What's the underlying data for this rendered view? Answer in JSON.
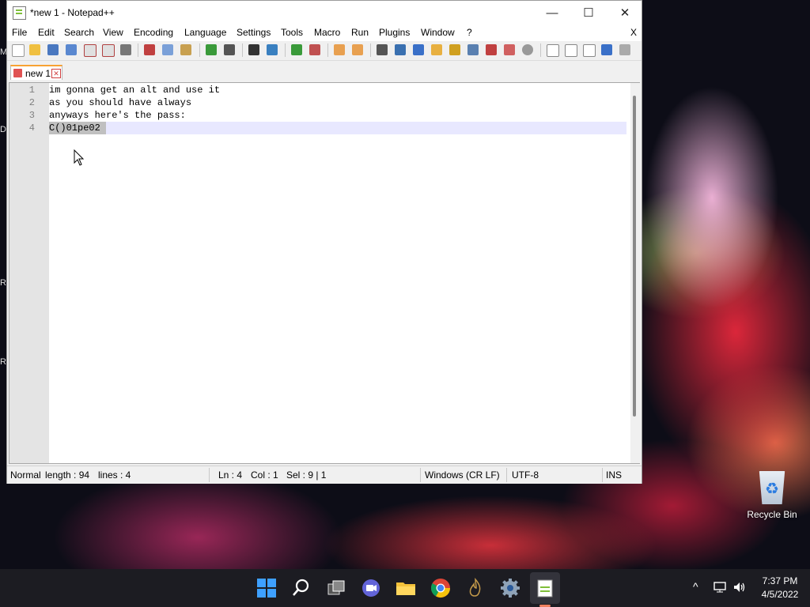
{
  "window": {
    "title": "*new 1 - Notepad++",
    "minimize": "—",
    "maximize": "☐",
    "close": "✕"
  },
  "menu": [
    "File",
    "Edit",
    "Search",
    "View",
    "Encoding",
    "Language",
    "Settings",
    "Tools",
    "Macro",
    "Run",
    "Plugins",
    "Window",
    "?"
  ],
  "menu_close": "X",
  "tab": {
    "label": "new 1",
    "close": "✕"
  },
  "editor": {
    "line_numbers": [
      "1",
      "2",
      "3",
      "4"
    ],
    "lines": [
      "im gonna get an alt and use it",
      "as you should have always",
      "anyways here's the pass:",
      "C()01pe02"
    ]
  },
  "status": {
    "mode": "Normal",
    "length": "length : 94",
    "lines": "lines : 4",
    "ln": "Ln : 4",
    "col": "Col : 1",
    "sel": "Sel : 9 | 1",
    "eol": "Windows (CR LF)",
    "encoding": "UTF-8",
    "ins": "INS"
  },
  "desktop": {
    "recycle_bin": "Recycle Bin",
    "edge_letters": [
      "M",
      "D",
      "R",
      "R"
    ]
  },
  "taskbar": {
    "time": "7:37 PM",
    "date": "4/5/2022",
    "chevron": "^"
  },
  "colors": {
    "accent_tab": "#f8a233",
    "taskbar_bg": "#1c1c22"
  }
}
